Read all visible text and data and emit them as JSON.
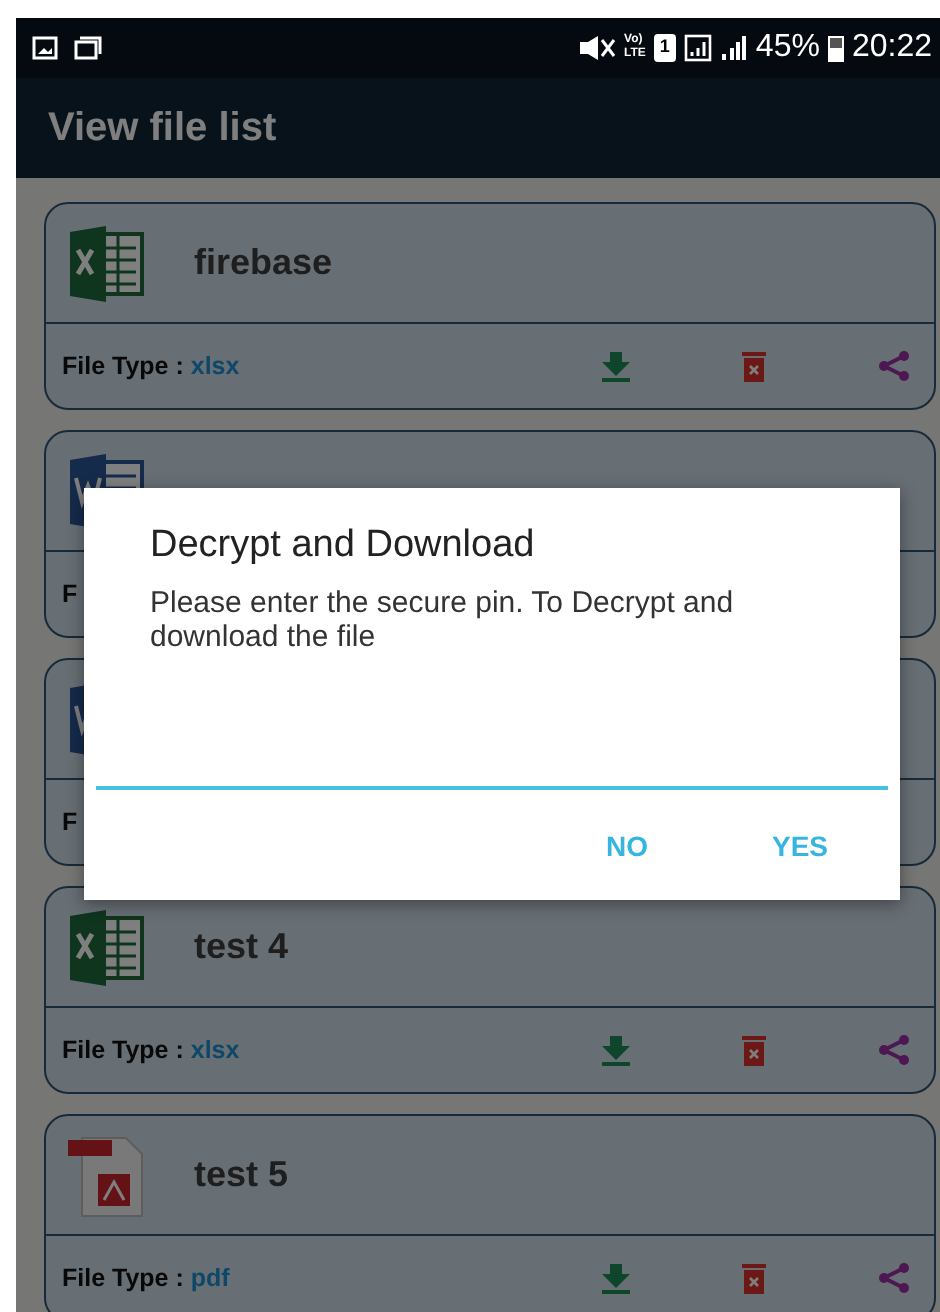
{
  "status_bar": {
    "volte": [
      "Vo)",
      "LTE"
    ],
    "sim": "1",
    "battery_text": "45%",
    "time": "20:22"
  },
  "app_bar": {
    "title": "View file list"
  },
  "files": [
    {
      "kind": "spreadsheet",
      "name": "firebase",
      "label": "File Type :",
      "type": "xlsx"
    },
    {
      "kind": "document",
      "label": "F"
    },
    {
      "kind": "document",
      "label": "F"
    },
    {
      "kind": "spreadsheet",
      "name": "test 4",
      "label": "File Type :",
      "type": "xlsx"
    },
    {
      "kind": "pdf",
      "name": "test 5",
      "label": "File Type :",
      "type": "pdf"
    }
  ],
  "dialog": {
    "title": "Decrypt and Download",
    "message": "Please enter the secure pin. To Decrypt and download the file",
    "buttons": [
      "NO",
      "YES"
    ]
  }
}
